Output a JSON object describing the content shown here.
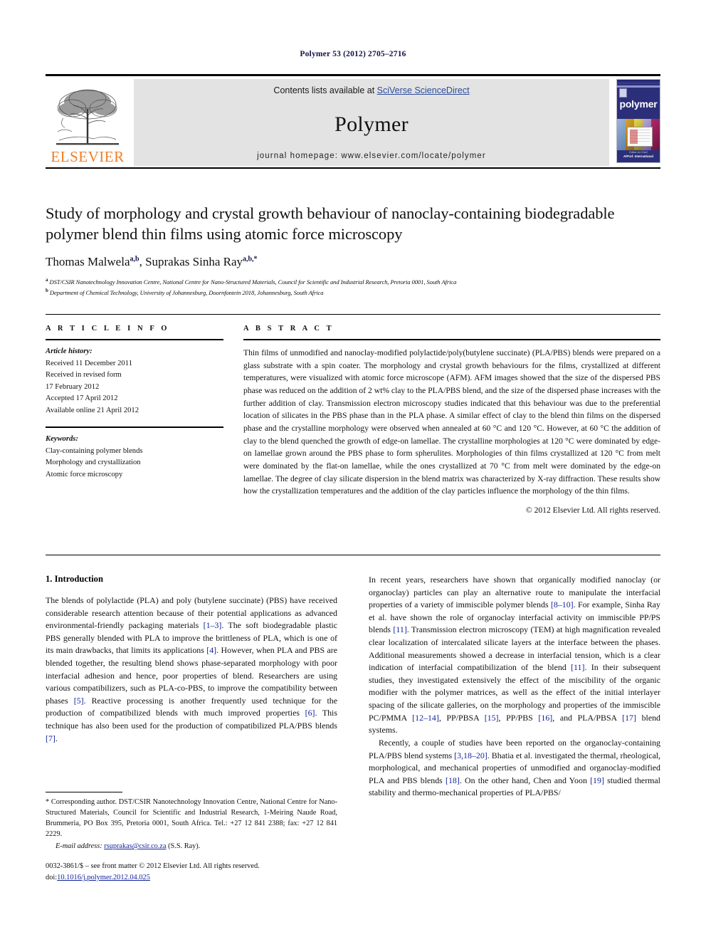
{
  "running_head": "Polymer 53 (2012) 2705–2716",
  "masthead": {
    "contents_prefix": "Contents lists available at ",
    "sciencedirect_link": "SciVerse ScienceDirect",
    "journal_title": "Polymer",
    "homepage_line": "journal homepage: www.elsevier.com/locate/polymer",
    "publisher_name": "ELSEVIER",
    "cover_name": "polymer",
    "cover_footer_top": "Editor-in-Chief",
    "cover_footer_bottom": "A/Prof. International",
    "accent_orange": "#f07e26",
    "link_blue": "#2a4b9b",
    "band_gray": "#e3e3e3"
  },
  "article": {
    "title": "Study of morphology and crystal growth behaviour of nanoclay-containing biodegradable polymer blend thin films using atomic force microscopy",
    "authors_plain": "Thomas Malwela",
    "author1": "Thomas Malwela",
    "author1_sup": "a,b",
    "author2": "Suprakas Sinha Ray",
    "author2_sup": "a,b,*",
    "affiliation_a_sup": "a",
    "affiliation_a": "DST/CSIR Nanotechnology Innovation Centre, National Centre for Nano-Structured Materials, Council for Scientific and Industrial Research, Pretoria 0001, South Africa",
    "affiliation_b_sup": "b",
    "affiliation_b": "Department of Chemical Technology, University of Johannesburg, Doornfontein 2018, Johannesburg, South Africa"
  },
  "article_info": {
    "heading": "A R T I C L E  I N F O",
    "history_label": "Article history:",
    "history": [
      "Received 11 December 2011",
      "Received in revised form",
      "17 February 2012",
      "Accepted 17 April 2012",
      "Available online 21 April 2012"
    ],
    "keywords_label": "Keywords:",
    "keywords": [
      "Clay-containing polymer blends",
      "Morphology and crystallization",
      "Atomic force microscopy"
    ]
  },
  "abstract": {
    "heading": "A B S T R A C T",
    "text": "Thin films of unmodified and nanoclay-modified polylactide/poly(butylene succinate) (PLA/PBS) blends were prepared on a glass substrate with a spin coater. The morphology and crystal growth behaviours for the films, crystallized at different temperatures, were visualized with atomic force microscope (AFM). AFM images showed that the size of the dispersed PBS phase was reduced on the addition of 2 wt% clay to the PLA/PBS blend, and the size of the dispersed phase increases with the further addition of clay. Transmission electron microscopy studies indicated that this behaviour was due to the preferential location of silicates in the PBS phase than in the PLA phase. A similar effect of clay to the blend thin films on the dispersed phase and the crystalline morphology were observed when annealed at 60 °C and 120 °C. However, at 60 °C the addition of clay to the blend quenched the growth of edge-on lamellae. The crystalline morphologies at 120 °C were dominated by edge-on lamellae grown around the PBS phase to form spherulites. Morphologies of thin films crystallized at 120 °C from melt were dominated by the flat-on lamellae, while the ones crystallized at 70 °C from melt were dominated by the edge-on lamellae. The degree of clay silicate dispersion in the blend matrix was characterized by X-ray diffraction. These results show how the crystallization temperatures and the addition of the clay particles influence the morphology of the thin films.",
    "copyright": "© 2012 Elsevier Ltd. All rights reserved."
  },
  "body": {
    "section_heading": "1. Introduction",
    "left_para_1_parts": [
      "The blends of polylactide (PLA) and poly (butylene succinate) (PBS) have received considerable research attention because of their potential applications as advanced environmental-friendly packaging materials ",
      "[1–3]",
      ". The soft biodegradable plastic PBS generally blended with PLA to improve the brittleness of PLA, which is one of its main drawbacks, that limits its applications ",
      "[4]",
      ". However, when PLA and PBS are blended together, the resulting blend shows phase-separated morphology with poor interfacial adhesion and hence, poor properties of blend. Researchers are using various compatibilizers, such as PLA-co-PBS, to improve the compatibility between phases ",
      "[5]",
      ". Reactive processing is another frequently used technique for the production of compatibilized blends with much improved properties ",
      "[6]",
      ". This technique has also been used for the production of compatibilized PLA/PBS blends ",
      "[7]",
      "."
    ],
    "right_para_1_parts": [
      "In recent years, researchers have shown that organically modified nanoclay (or organoclay) particles can play an alternative route to manipulate the interfacial properties of a variety of immiscible polymer blends ",
      "[8–10]",
      ". For example, Sinha Ray et al. have shown the role of organoclay interfacial activity on immiscible PP/PS blends ",
      "[11]",
      ". Transmission electron microscopy (TEM) at high magnification revealed clear localization of intercalated silicate layers at the interface between the phases. Additional measurements showed a decrease in interfacial tension, which is a clear indication of interfacial compatibilization of the blend ",
      "[11]",
      ". In their subsequent studies, they investigated extensively the effect of the miscibility of the organic modifier with the polymer matrices, as well as the effect of the initial interlayer spacing of the silicate galleries, on the morphology and properties of the immiscible PC/PMMA ",
      "[12–14]",
      ", PP/PBSA ",
      "[15]",
      ", PP/PBS ",
      "[16]",
      ", and PLA/PBSA ",
      "[17]",
      " blend systems."
    ],
    "right_para_2_parts": [
      "Recently, a couple of studies have been reported on the organoclay-containing PLA/PBS blend systems ",
      "[3,18–20]",
      ". Bhatia et al. investigated the thermal, rheological, morphological, and mechanical properties of unmodified and organoclay-modified PLA and PBS blends ",
      "[18]",
      ". On the other hand, Chen and Yoon ",
      "[19]",
      " studied thermal stability and thermo-mechanical properties of PLA/PBS/"
    ]
  },
  "footnote": {
    "marker": "*",
    "text": " Corresponding author. DST/CSIR Nanotechnology Innovation Centre, National Centre for Nano-Structured Materials, Council for Scientific and Industrial Research, 1-Meiring Naude Road, Brummeria, PO Box 395, Pretoria 0001, South Africa. Tel.: +27 12 841 2388; fax: +27 12 841 2229.",
    "email_label": "E-mail address:",
    "email": "rsuprakas@csir.co.za",
    "email_suffix": " (S.S. Ray)."
  },
  "imprint": {
    "line1": "0032-3861/$ – see front matter © 2012 Elsevier Ltd. All rights reserved.",
    "doi_label": "doi:",
    "doi_value": "10.1016/j.polymer.2012.04.025"
  }
}
